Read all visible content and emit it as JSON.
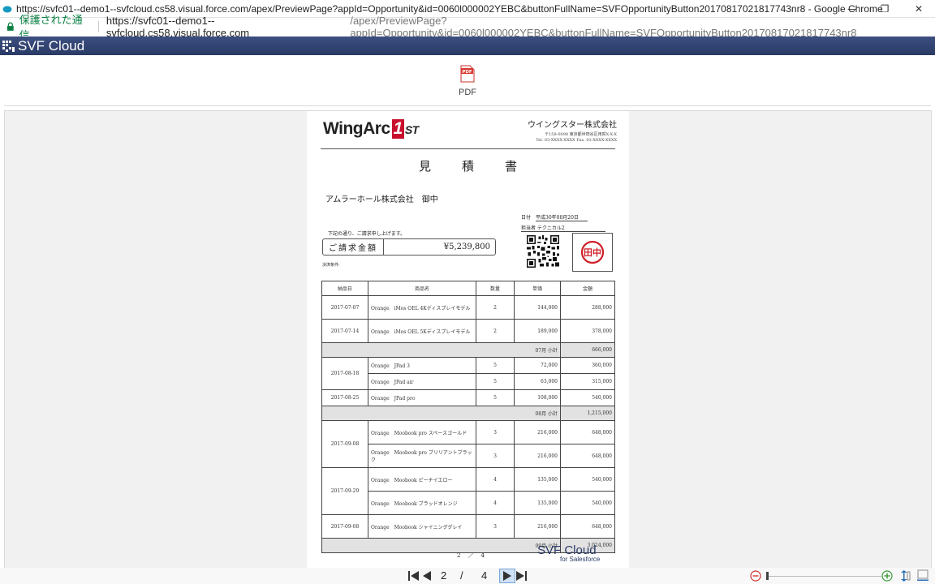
{
  "window": {
    "title": "https://svfc01--demo1--svfcloud.cs58.visual.force.com/apex/PreviewPage?appId=Opportunity&id=0060l000002YEBC&buttonFullName=SVFOpportunityButton20170817021817743nr8 - Google Chrome",
    "minimize": "—",
    "restore": "❐",
    "close": "✕"
  },
  "addressbar": {
    "secure_label": "保護された通信",
    "url_host": "https://svfc01--demo1--svfcloud.cs58.visual.force.com",
    "url_path": "/apex/PreviewPage?appId=Opportunity&id=0060l000002YEBC&buttonFullName=SVFOpportunityButton20170817021817743nr8"
  },
  "header": {
    "brand": "SVF Cloud"
  },
  "toolbar": {
    "pdf_icon_text": "PDF",
    "pdf_label": "PDF"
  },
  "document": {
    "logo_main": "WingArc",
    "logo_one": "1",
    "logo_st": "ST",
    "company_name": "ウイングスター株式会社",
    "company_address": "〒158-0098 東京都世田谷区用賀X-X-X",
    "company_tel": "Tel. 03-XXXX-XXXX  Fax. 03-XXXX-XXXX",
    "title": "見積書",
    "recipient": "アムラーホール株式会社　御中",
    "date_label": "日付",
    "date_value": "平成30年08月20日",
    "staff": "担当者 テクニカル2",
    "notice": "下記の通り、ご請求申し上げます。",
    "amount_label": "ご請求金額",
    "amount_value": "¥5,239,800",
    "terms_label": "決済条件:",
    "stamp_char": "田中",
    "table_headers": {
      "date": "納品日",
      "product": "商品名",
      "qty": "数量",
      "price": "単価",
      "amount": "金額"
    },
    "groups": [
      {
        "rows": [
          {
            "date": "2017-07-07",
            "product": "Orange　iMos OEL 4Kディスプレイモデル",
            "qty": "2",
            "price": "144,000",
            "amount": "288,000"
          },
          {
            "date": "2017-07-14",
            "product": "Orange　iMos OEL 5Kディスプレイモデル",
            "qty": "2",
            "price": "189,000",
            "amount": "378,000"
          }
        ],
        "subtotal_label": "07月 小計",
        "subtotal": "666,000"
      },
      {
        "rows": [
          {
            "date": "2017-08-18",
            "product": "Orange　JPad 3",
            "qty": "5",
            "price": "72,000",
            "amount": "360,000"
          },
          {
            "date": "",
            "product": "Orange　JPad air",
            "qty": "5",
            "price": "63,000",
            "amount": "315,000"
          },
          {
            "date": "2017-08-25",
            "product": "Orange　JPad pro",
            "qty": "5",
            "price": "108,000",
            "amount": "540,000"
          }
        ],
        "subtotal_label": "08月 小計",
        "subtotal": "1,215,000"
      },
      {
        "rows": [
          {
            "date": "2017-09-08",
            "product": "Orange　Moobook pro スペースゴールド",
            "qty": "3",
            "price": "216,000",
            "amount": "648,000"
          },
          {
            "date": "",
            "product": "Orange　Moobook pro ブリリアントブラック",
            "qty": "3",
            "price": "216,000",
            "amount": "648,000"
          },
          {
            "date": "2017-09-29",
            "product": "Orange　Moobook ピーチイエロー",
            "qty": "4",
            "price": "135,000",
            "amount": "540,000"
          },
          {
            "date": "",
            "product": "Orange　Moobook ブラッドオレンジ",
            "qty": "4",
            "price": "135,000",
            "amount": "540,000"
          },
          {
            "date": "2017-09-08",
            "product": "Orange　Moobook シャイニンググレイ",
            "qty": "3",
            "price": "216,000",
            "amount": "648,000"
          }
        ],
        "subtotal_label": "09月 小計",
        "subtotal": "3,024,000"
      }
    ],
    "page_indicator": "2　／　4",
    "footer_logo": "SVF Cloud",
    "footer_logo_sub": "for Salesforce"
  },
  "pager": {
    "current": "2",
    "separator": "/",
    "total": "4"
  },
  "colors": {
    "header_bg": "#2a3a66",
    "secure_green": "#0b8043",
    "logo_red": "#c8102e"
  }
}
